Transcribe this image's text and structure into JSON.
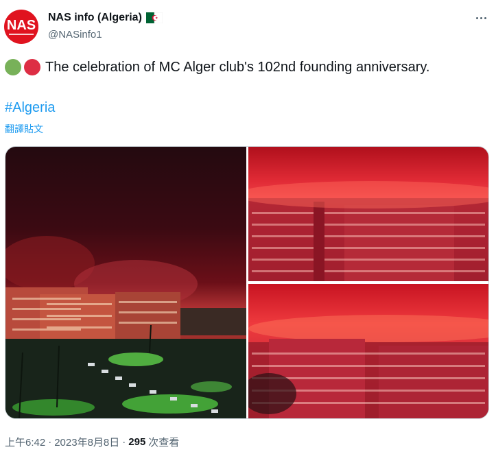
{
  "author": {
    "avatar_text": "NAS",
    "display_name": "NAS info (Algeria)",
    "flag_icon": "algeria-flag-icon",
    "handle": "@NASinfo1"
  },
  "tweet": {
    "emoji_colors": [
      "#78b159",
      "#dd2e44"
    ],
    "text": "The celebration of MC Alger club's 102nd founding anniversary.",
    "hashtag": "#Algeria",
    "translate_label": "翻譯貼文"
  },
  "footer": {
    "time": "上午6:42",
    "date": "2023年8月8日",
    "separator": "·",
    "views_count": "295",
    "views_label": "次查看"
  },
  "colors": {
    "accent": "#1d9bf0",
    "brand_red": "#e0131f"
  }
}
